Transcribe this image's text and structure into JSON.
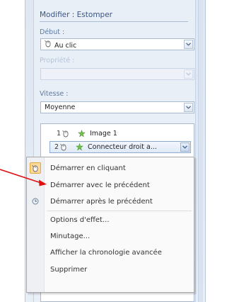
{
  "pane": {
    "title": "Modifier : Estomper",
    "start": {
      "label": "Début :",
      "value": "Au clic"
    },
    "property": {
      "label": "Propriété :",
      "value": ""
    },
    "speed": {
      "label": "Vitesse :",
      "value": "Moyenne"
    }
  },
  "animation_list": {
    "items": [
      {
        "number": "1",
        "name": "Image 1"
      },
      {
        "number": "2",
        "name": "Connecteur droit a..."
      }
    ]
  },
  "context_menu": {
    "items": [
      {
        "label": "Démarrer en cliquant",
        "icon": "mouse-icon",
        "checked": true
      },
      {
        "label": "Démarrer avec le précédent",
        "icon": "",
        "checked": false
      },
      {
        "label": "Démarrer après le précédent",
        "icon": "clock-icon",
        "checked": false
      },
      {
        "label": "Options d'effet...",
        "icon": "",
        "checked": false
      },
      {
        "label": "Minutage...",
        "icon": "",
        "checked": false
      },
      {
        "label": "Afficher la chronologie avancée",
        "icon": "",
        "checked": false
      },
      {
        "label": "Supprimer",
        "icon": "",
        "checked": false
      }
    ]
  },
  "colors": {
    "annotation_arrow": "#e01010",
    "accent_text": "#3a5580",
    "menu_highlight": "#fcd89a"
  }
}
